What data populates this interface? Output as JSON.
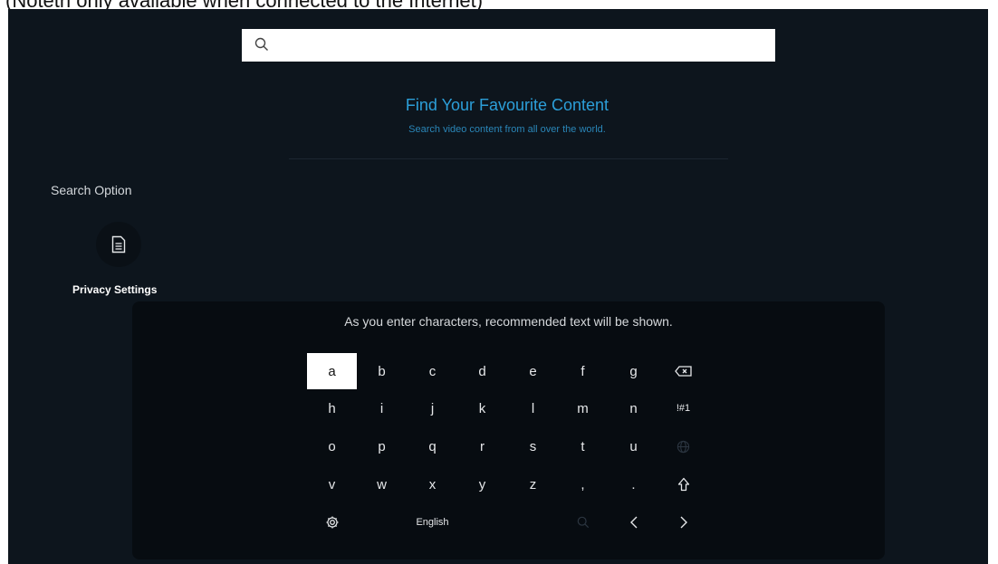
{
  "caption": "(Notetn only available when connected to the Internet)",
  "search": {
    "placeholder": "",
    "value": ""
  },
  "banner": {
    "title": "Find Your Favourite Content",
    "subtitle": "Search video content from all over the world."
  },
  "sidebar": {
    "search_option_label": "Search Option",
    "privacy_settings_label": "Privacy Settings"
  },
  "keyboard": {
    "hint": "As you enter characters, recommended text will be shown.",
    "row1": [
      "a",
      "b",
      "c",
      "d",
      "e",
      "f",
      "g"
    ],
    "row2": [
      "h",
      "i",
      "j",
      "k",
      "l",
      "m",
      "n"
    ],
    "row3": [
      "o",
      "p",
      "q",
      "r",
      "s",
      "t",
      "u"
    ],
    "row4": [
      "v",
      "w",
      "x",
      "y",
      "z",
      ",",
      "."
    ],
    "symbols_label": "!#1",
    "language_label": "English",
    "selected_key": "a"
  },
  "colors": {
    "accent": "#2c9fd9",
    "background": "#0d151d"
  }
}
